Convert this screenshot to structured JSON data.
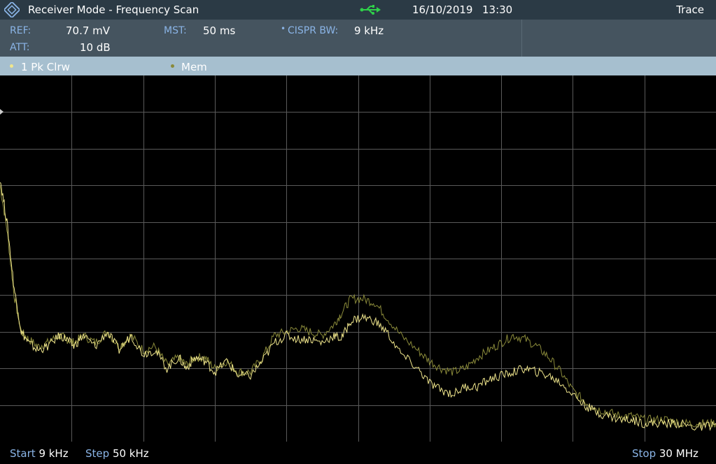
{
  "header": {
    "title": "Receiver Mode - Frequency Scan",
    "date": "16/10/2019",
    "time": "13:30",
    "trace_button": "Trace",
    "logo_icon": "rohde-schwarz-logo",
    "usb_icon": "usb-icon",
    "usb_color": "#2fd04a"
  },
  "params": {
    "ref_label": "REF:",
    "ref_value": "70.7 mV",
    "att_label": "ATT:",
    "att_value": "10 dB",
    "mst_label": "MST:",
    "mst_value": "50 ms",
    "cispr_marker": "•",
    "cispr_label": "CISPR BW:",
    "cispr_value": "9 kHz"
  },
  "traces": {
    "trace1_label": "1 Pk  Clrw",
    "trace1_color": "#f0e68c",
    "mem_label": "Mem",
    "mem_color": "#8a8a3a"
  },
  "footer": {
    "start_key": "Start",
    "start_value": "9 kHz",
    "step_key": "Step",
    "step_value": "50 kHz",
    "stop_key": "Stop",
    "stop_value": "30 MHz"
  },
  "chart_data": {
    "type": "line",
    "title": "",
    "xlabel": "",
    "ylabel": "",
    "xlim": [
      0.009,
      30
    ],
    "x_unit": "MHz",
    "grid": true,
    "grid_divisions": {
      "x": 10,
      "y": 10
    },
    "y_range_divisions": [
      0,
      10
    ],
    "series": [
      {
        "name": "1 Pk Clrw",
        "color": "#f0e68c",
        "x": [
          0.009,
          0.3,
          0.6,
          0.9,
          1.2,
          1.6,
          2.0,
          2.5,
          2.8,
          3.1,
          3.5,
          4.0,
          4.5,
          5.0,
          5.5,
          6.0,
          6.5,
          7.0,
          7.5,
          7.8,
          8.2,
          8.6,
          9.0,
          9.5,
          10.0,
          10.5,
          11.0,
          11.5,
          12.0,
          12.5,
          13.0,
          13.5,
          14.0,
          14.3,
          14.7,
          15.2,
          15.7,
          16.2,
          16.8,
          17.5,
          18.0,
          18.5,
          19.0,
          19.5,
          20.0,
          20.5,
          21.0,
          21.5,
          22.0,
          22.5,
          23.0,
          23.5,
          24.0,
          24.5,
          25.0,
          25.5,
          26.0,
          26.5,
          27.0,
          27.5,
          28.0,
          28.5,
          29.0,
          29.5,
          30.0
        ],
        "y": [
          7.2,
          6.0,
          4.2,
          3.0,
          2.7,
          2.5,
          2.6,
          2.9,
          2.8,
          2.6,
          2.9,
          2.6,
          3.0,
          2.5,
          2.9,
          2.4,
          2.5,
          2.0,
          2.3,
          2.0,
          2.3,
          2.2,
          1.9,
          2.2,
          1.8,
          1.8,
          2.2,
          2.7,
          2.9,
          2.8,
          2.8,
          2.7,
          2.9,
          2.8,
          3.3,
          3.4,
          3.3,
          3.0,
          2.4,
          2.0,
          1.6,
          1.4,
          1.3,
          1.5,
          1.5,
          1.7,
          1.8,
          1.9,
          2.0,
          1.9,
          1.8,
          1.6,
          1.3,
          1.0,
          0.8,
          0.7,
          0.6,
          0.6,
          0.5,
          0.5,
          0.5,
          0.5,
          0.4,
          0.4,
          0.5
        ]
      },
      {
        "name": "Mem",
        "color": "#8a8a3a",
        "x": [
          0.009,
          0.3,
          0.6,
          0.9,
          1.2,
          1.6,
          2.0,
          2.5,
          2.8,
          3.1,
          3.5,
          4.0,
          4.5,
          5.0,
          5.5,
          6.0,
          6.5,
          7.0,
          7.5,
          7.8,
          8.2,
          8.6,
          9.0,
          9.5,
          10.0,
          10.5,
          11.0,
          11.5,
          12.0,
          12.5,
          13.0,
          13.5,
          14.0,
          14.3,
          14.7,
          15.2,
          15.7,
          16.2,
          16.8,
          17.5,
          18.0,
          18.5,
          19.0,
          19.5,
          20.0,
          20.5,
          21.0,
          21.5,
          22.0,
          22.5,
          23.0,
          23.5,
          24.0,
          24.5,
          25.0,
          25.5,
          26.0,
          26.5,
          27.0,
          27.5,
          28.0,
          28.5,
          29.0,
          29.5,
          30.0
        ],
        "y": [
          7.0,
          5.8,
          4.0,
          3.0,
          2.8,
          2.6,
          2.7,
          2.9,
          2.8,
          2.7,
          2.9,
          2.7,
          3.0,
          2.6,
          2.9,
          2.5,
          2.6,
          2.1,
          2.3,
          2.1,
          2.3,
          2.3,
          2.0,
          2.2,
          1.9,
          1.9,
          2.3,
          2.9,
          3.0,
          3.1,
          3.0,
          2.9,
          3.2,
          3.5,
          3.9,
          3.9,
          3.8,
          3.4,
          2.9,
          2.5,
          2.2,
          2.0,
          1.9,
          2.0,
          2.3,
          2.5,
          2.7,
          2.9,
          2.8,
          2.6,
          2.3,
          1.9,
          1.4,
          1.1,
          0.9,
          0.8,
          0.7,
          0.7,
          0.6,
          0.6,
          0.6,
          0.5,
          0.5,
          0.5,
          0.5
        ]
      }
    ]
  }
}
